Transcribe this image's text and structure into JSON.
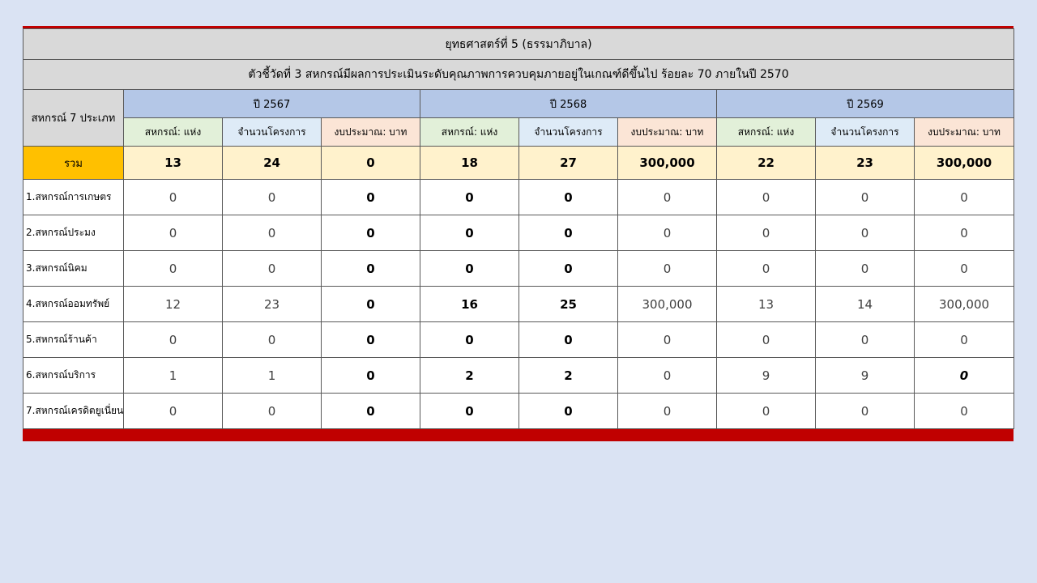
{
  "strategy_title": "ยุทธศาสตร์ที่ 5 (ธรรมาภิบาล)",
  "indicator_title": "ตัวชี้วัดที่ 3 สหกรณ์มีผลการประเมินระดับคุณภาพการควบคุมภายอยู่ในเกณฑ์ดีขึ้นไป ร้อยละ 70 ภายในปี 2570",
  "row_header": "สหกรณ์ 7 ประเภท",
  "years": [
    "ปี 2567",
    "ปี 2568",
    "ปี 2569"
  ],
  "subheaders": [
    "สหกรณ์: แห่ง",
    "จำนวนโครงการ",
    "งบประมาณ: บาท"
  ],
  "total": {
    "label": "รวม",
    "values": [
      "13",
      "24",
      "0",
      "18",
      "27",
      "300,000",
      "22",
      "23",
      "300,000"
    ]
  },
  "rows": [
    {
      "label": "1.สหกรณ์การเกษตร",
      "values": [
        "0",
        "0",
        "0",
        "0",
        "0",
        "0",
        "0",
        "0",
        "0"
      ]
    },
    {
      "label": "2.สหกรณ์ประมง",
      "values": [
        "0",
        "0",
        "0",
        "0",
        "0",
        "0",
        "0",
        "0",
        "0"
      ]
    },
    {
      "label": "3.สหกรณ์นิคม",
      "values": [
        "0",
        "0",
        "0",
        "0",
        "0",
        "0",
        "0",
        "0",
        "0"
      ]
    },
    {
      "label": "4.สหกรณ์ออมทรัพย์",
      "values": [
        "12",
        "23",
        "0",
        "16",
        "25",
        "300,000",
        "13",
        "14",
        "300,000"
      ]
    },
    {
      "label": "5.สหกรณ์ร้านค้า",
      "values": [
        "0",
        "0",
        "0",
        "0",
        "0",
        "0",
        "0",
        "0",
        "0"
      ]
    },
    {
      "label": "6.สหกรณ์บริการ",
      "values": [
        "1",
        "1",
        "0",
        "2",
        "2",
        "0",
        "9",
        "9",
        "0"
      ]
    },
    {
      "label": "7.สหกรณ์เครดิตยูเนี่ยน",
      "values": [
        "0",
        "0",
        "0",
        "0",
        "0",
        "0",
        "0",
        "0",
        "0"
      ]
    }
  ],
  "colors": {
    "page_background": "#dae3f3",
    "accent_bar": "#c00000",
    "header_gray": "#d9d9d9",
    "year_blue": "#b4c7e7",
    "total_label": "#ffc000",
    "total_row": "#fff2cc"
  }
}
